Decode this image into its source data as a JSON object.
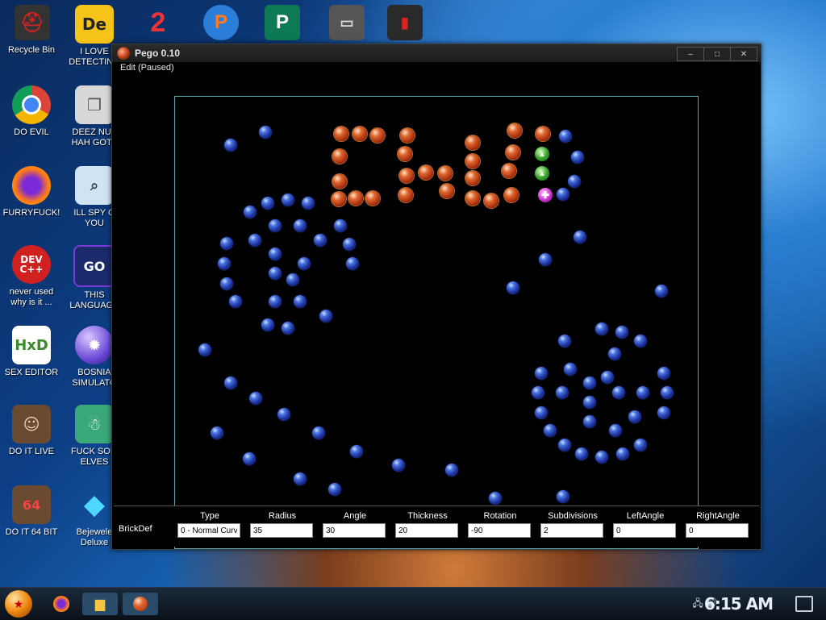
{
  "desktop": {
    "icons": [
      {
        "label": "Recycle Bin",
        "icon": "recycle-bin-icon"
      },
      {
        "label": "I LOVE\nDETECTING",
        "icon": "de-app-icon"
      },
      {
        "label": "DO EVIL",
        "icon": "chrome-icon"
      },
      {
        "label": "DEEZ NUT\nHAH GOTT",
        "icon": "copy-icon"
      },
      {
        "label": "FURRYFUCK!",
        "icon": "firefox-icon"
      },
      {
        "label": "ILL SPY O\nYOU",
        "icon": "spy-icon"
      },
      {
        "label": "never used\nwhy is it ...",
        "icon": "devcpp-icon"
      },
      {
        "label": "THIS\nLANGUAGE",
        "icon": "go-icon"
      },
      {
        "label": "SEX EDITOR",
        "icon": "hxd-icon"
      },
      {
        "label": "BOSNIA\nSIMULATO",
        "icon": "spiked-ball-icon"
      },
      {
        "label": "DO IT LIVE",
        "icon": "portrait-icon"
      },
      {
        "label": "FUCK SOM\nELVES",
        "icon": "elf-icon"
      },
      {
        "label": "DO IT 64 BIT",
        "icon": "portrait-64-icon"
      },
      {
        "label": "Bejewele\nDeluxe",
        "icon": "diamond-icon"
      }
    ],
    "top_icons": [
      "helmet-icon",
      "two-icon",
      "p-app-icon",
      "publisher-icon",
      "monitor-icon",
      "tower-icon"
    ]
  },
  "window": {
    "title": "Pego 0.10",
    "menu": "Edit (Paused)",
    "minimize": "–",
    "maximize": "□",
    "close": "✕"
  },
  "brickdef": {
    "title": "BrickDef",
    "fields": [
      {
        "label": "Type",
        "value": "0 - Normal Curv"
      },
      {
        "label": "Radius",
        "value": "35"
      },
      {
        "label": "Angle",
        "value": "30"
      },
      {
        "label": "Thickness",
        "value": "20"
      },
      {
        "label": "Rotation",
        "value": "-90"
      },
      {
        "label": "Subdivisions",
        "value": "2"
      },
      {
        "label": "LeftAngle",
        "value": "0"
      },
      {
        "label": "RightAngle",
        "value": "0"
      }
    ]
  },
  "taskbar": {
    "clock": "6:15 AM",
    "buttons": [
      "firefox-icon",
      "folder-icon",
      "pego-icon"
    ]
  },
  "colors": {
    "peg_blue": "#2a44c8",
    "peg_orange": "#d0501c",
    "peg_green": "#3aa832",
    "peg_purple": "#d02fd0",
    "board_border": "#5fa7b0"
  }
}
